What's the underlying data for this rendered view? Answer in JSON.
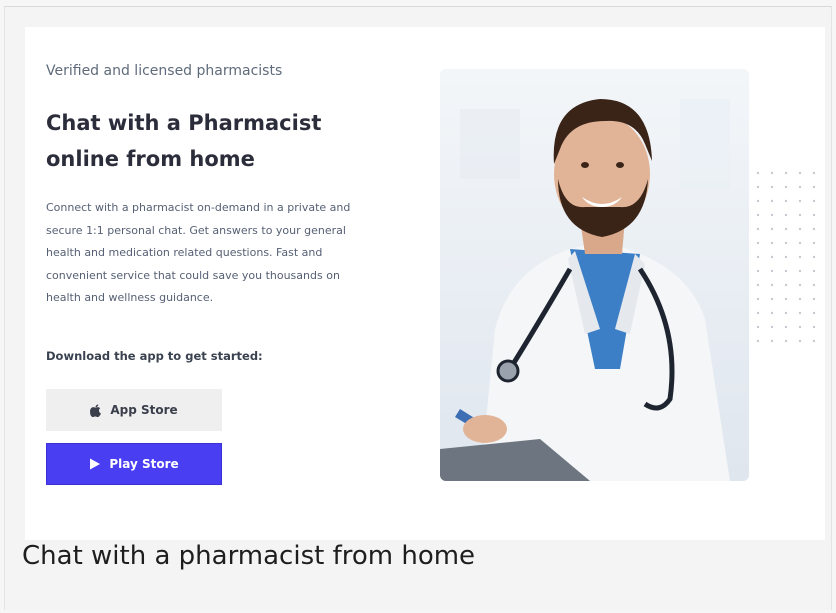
{
  "hero": {
    "eyebrow": "Verified and licensed pharmacists",
    "title_line1": "Chat with a Pharmacist",
    "title_line2": "online from home",
    "description": "Connect with a pharmacist on-demand in a private and secure 1:1 personal chat. Get answers to your general health and medication related questions. Fast and convenient service that could save you thousands on health and wellness guidance.",
    "cta_heading": "Download the app to get started:"
  },
  "buttons": {
    "app_store_label": "App Store",
    "play_store_label": "Play Store",
    "app_store_icon": "apple-icon",
    "play_store_icon": "play-icon"
  },
  "image": {
    "subject": "pharmacist-photo"
  },
  "caption": "Chat with a pharmacist from home",
  "colors": {
    "accent": "#4a3ef2",
    "title": "#2b2d3b",
    "body_text": "#566074",
    "secondary_button": "#efefef"
  }
}
